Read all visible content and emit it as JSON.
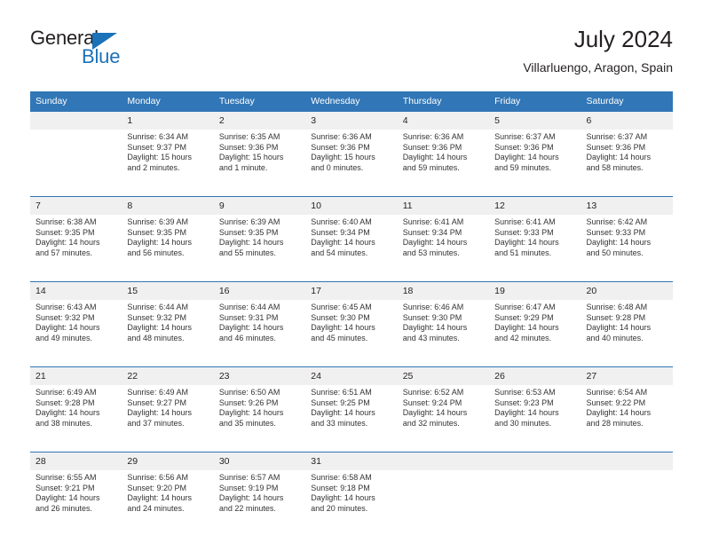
{
  "logo": {
    "word_general": "General",
    "word_blue": "Blue",
    "triangle_color": "#1b72b8"
  },
  "header": {
    "title": "July 2024",
    "subtitle": "Villarluengo, Aragon, Spain"
  },
  "colors": {
    "header_bar": "#3176b6",
    "daynum_band": "#f0f0f0",
    "text": "#231f20",
    "detail_text": "#333333"
  },
  "weekday_headers": [
    "Sunday",
    "Monday",
    "Tuesday",
    "Wednesday",
    "Thursday",
    "Friday",
    "Saturday"
  ],
  "weeks": [
    [
      {
        "day": "",
        "sunrise": "",
        "sunset": "",
        "daylight_1": "",
        "daylight_2": ""
      },
      {
        "day": "1",
        "sunrise": "Sunrise: 6:34 AM",
        "sunset": "Sunset: 9:37 PM",
        "daylight_1": "Daylight: 15 hours",
        "daylight_2": "and 2 minutes."
      },
      {
        "day": "2",
        "sunrise": "Sunrise: 6:35 AM",
        "sunset": "Sunset: 9:36 PM",
        "daylight_1": "Daylight: 15 hours",
        "daylight_2": "and 1 minute."
      },
      {
        "day": "3",
        "sunrise": "Sunrise: 6:36 AM",
        "sunset": "Sunset: 9:36 PM",
        "daylight_1": "Daylight: 15 hours",
        "daylight_2": "and 0 minutes."
      },
      {
        "day": "4",
        "sunrise": "Sunrise: 6:36 AM",
        "sunset": "Sunset: 9:36 PM",
        "daylight_1": "Daylight: 14 hours",
        "daylight_2": "and 59 minutes."
      },
      {
        "day": "5",
        "sunrise": "Sunrise: 6:37 AM",
        "sunset": "Sunset: 9:36 PM",
        "daylight_1": "Daylight: 14 hours",
        "daylight_2": "and 59 minutes."
      },
      {
        "day": "6",
        "sunrise": "Sunrise: 6:37 AM",
        "sunset": "Sunset: 9:36 PM",
        "daylight_1": "Daylight: 14 hours",
        "daylight_2": "and 58 minutes."
      }
    ],
    [
      {
        "day": "7",
        "sunrise": "Sunrise: 6:38 AM",
        "sunset": "Sunset: 9:35 PM",
        "daylight_1": "Daylight: 14 hours",
        "daylight_2": "and 57 minutes."
      },
      {
        "day": "8",
        "sunrise": "Sunrise: 6:39 AM",
        "sunset": "Sunset: 9:35 PM",
        "daylight_1": "Daylight: 14 hours",
        "daylight_2": "and 56 minutes."
      },
      {
        "day": "9",
        "sunrise": "Sunrise: 6:39 AM",
        "sunset": "Sunset: 9:35 PM",
        "daylight_1": "Daylight: 14 hours",
        "daylight_2": "and 55 minutes."
      },
      {
        "day": "10",
        "sunrise": "Sunrise: 6:40 AM",
        "sunset": "Sunset: 9:34 PM",
        "daylight_1": "Daylight: 14 hours",
        "daylight_2": "and 54 minutes."
      },
      {
        "day": "11",
        "sunrise": "Sunrise: 6:41 AM",
        "sunset": "Sunset: 9:34 PM",
        "daylight_1": "Daylight: 14 hours",
        "daylight_2": "and 53 minutes."
      },
      {
        "day": "12",
        "sunrise": "Sunrise: 6:41 AM",
        "sunset": "Sunset: 9:33 PM",
        "daylight_1": "Daylight: 14 hours",
        "daylight_2": "and 51 minutes."
      },
      {
        "day": "13",
        "sunrise": "Sunrise: 6:42 AM",
        "sunset": "Sunset: 9:33 PM",
        "daylight_1": "Daylight: 14 hours",
        "daylight_2": "and 50 minutes."
      }
    ],
    [
      {
        "day": "14",
        "sunrise": "Sunrise: 6:43 AM",
        "sunset": "Sunset: 9:32 PM",
        "daylight_1": "Daylight: 14 hours",
        "daylight_2": "and 49 minutes."
      },
      {
        "day": "15",
        "sunrise": "Sunrise: 6:44 AM",
        "sunset": "Sunset: 9:32 PM",
        "daylight_1": "Daylight: 14 hours",
        "daylight_2": "and 48 minutes."
      },
      {
        "day": "16",
        "sunrise": "Sunrise: 6:44 AM",
        "sunset": "Sunset: 9:31 PM",
        "daylight_1": "Daylight: 14 hours",
        "daylight_2": "and 46 minutes."
      },
      {
        "day": "17",
        "sunrise": "Sunrise: 6:45 AM",
        "sunset": "Sunset: 9:30 PM",
        "daylight_1": "Daylight: 14 hours",
        "daylight_2": "and 45 minutes."
      },
      {
        "day": "18",
        "sunrise": "Sunrise: 6:46 AM",
        "sunset": "Sunset: 9:30 PM",
        "daylight_1": "Daylight: 14 hours",
        "daylight_2": "and 43 minutes."
      },
      {
        "day": "19",
        "sunrise": "Sunrise: 6:47 AM",
        "sunset": "Sunset: 9:29 PM",
        "daylight_1": "Daylight: 14 hours",
        "daylight_2": "and 42 minutes."
      },
      {
        "day": "20",
        "sunrise": "Sunrise: 6:48 AM",
        "sunset": "Sunset: 9:28 PM",
        "daylight_1": "Daylight: 14 hours",
        "daylight_2": "and 40 minutes."
      }
    ],
    [
      {
        "day": "21",
        "sunrise": "Sunrise: 6:49 AM",
        "sunset": "Sunset: 9:28 PM",
        "daylight_1": "Daylight: 14 hours",
        "daylight_2": "and 38 minutes."
      },
      {
        "day": "22",
        "sunrise": "Sunrise: 6:49 AM",
        "sunset": "Sunset: 9:27 PM",
        "daylight_1": "Daylight: 14 hours",
        "daylight_2": "and 37 minutes."
      },
      {
        "day": "23",
        "sunrise": "Sunrise: 6:50 AM",
        "sunset": "Sunset: 9:26 PM",
        "daylight_1": "Daylight: 14 hours",
        "daylight_2": "and 35 minutes."
      },
      {
        "day": "24",
        "sunrise": "Sunrise: 6:51 AM",
        "sunset": "Sunset: 9:25 PM",
        "daylight_1": "Daylight: 14 hours",
        "daylight_2": "and 33 minutes."
      },
      {
        "day": "25",
        "sunrise": "Sunrise: 6:52 AM",
        "sunset": "Sunset: 9:24 PM",
        "daylight_1": "Daylight: 14 hours",
        "daylight_2": "and 32 minutes."
      },
      {
        "day": "26",
        "sunrise": "Sunrise: 6:53 AM",
        "sunset": "Sunset: 9:23 PM",
        "daylight_1": "Daylight: 14 hours",
        "daylight_2": "and 30 minutes."
      },
      {
        "day": "27",
        "sunrise": "Sunrise: 6:54 AM",
        "sunset": "Sunset: 9:22 PM",
        "daylight_1": "Daylight: 14 hours",
        "daylight_2": "and 28 minutes."
      }
    ],
    [
      {
        "day": "28",
        "sunrise": "Sunrise: 6:55 AM",
        "sunset": "Sunset: 9:21 PM",
        "daylight_1": "Daylight: 14 hours",
        "daylight_2": "and 26 minutes."
      },
      {
        "day": "29",
        "sunrise": "Sunrise: 6:56 AM",
        "sunset": "Sunset: 9:20 PM",
        "daylight_1": "Daylight: 14 hours",
        "daylight_2": "and 24 minutes."
      },
      {
        "day": "30",
        "sunrise": "Sunrise: 6:57 AM",
        "sunset": "Sunset: 9:19 PM",
        "daylight_1": "Daylight: 14 hours",
        "daylight_2": "and 22 minutes."
      },
      {
        "day": "31",
        "sunrise": "Sunrise: 6:58 AM",
        "sunset": "Sunset: 9:18 PM",
        "daylight_1": "Daylight: 14 hours",
        "daylight_2": "and 20 minutes."
      },
      {
        "day": "",
        "sunrise": "",
        "sunset": "",
        "daylight_1": "",
        "daylight_2": ""
      },
      {
        "day": "",
        "sunrise": "",
        "sunset": "",
        "daylight_1": "",
        "daylight_2": ""
      },
      {
        "day": "",
        "sunrise": "",
        "sunset": "",
        "daylight_1": "",
        "daylight_2": ""
      }
    ]
  ]
}
